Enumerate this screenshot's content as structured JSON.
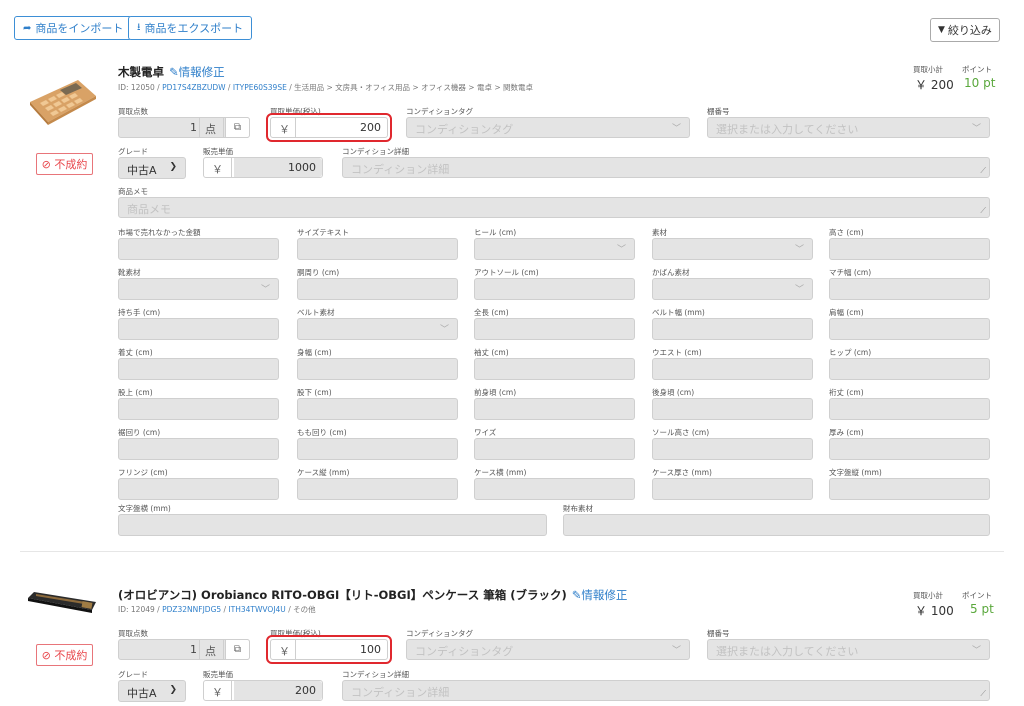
{
  "toolbar": {
    "import_label": "商品をインポート",
    "export_label": "商品をエクスポート",
    "filter_label": "絞り込み"
  },
  "labels": {
    "qty": "買取点数",
    "unit_price": "買取単価(税込)",
    "condition_tag": "コンディションタグ",
    "shelf": "棚番号",
    "grade": "グレード",
    "sale_price": "販売単価",
    "condition_detail": "コンディション詳細",
    "memo": "商品メモ",
    "subtotal": "買取小計",
    "points": "ポイント",
    "unit": "点",
    "yen": "￥",
    "not_contracted": "⊘ 不成約",
    "edit": "情報修正"
  },
  "placeholders": {
    "condition_tag": "コンディションタグ",
    "shelf": "選択または入力してください",
    "condition_detail": "コンディション詳細",
    "memo": "商品メモ"
  },
  "items": [
    {
      "title": "木製電卓",
      "id_text": "ID: 12050 / ",
      "code1": "PD17S4ZBZUDW",
      "code2": "ITYPE60S39SE",
      "category": " / 生活用品 > 文房具・オフィス用品 > オフィス機器 > 電卓 > 関数電卓",
      "qty": "1",
      "unit_price": "200",
      "grade": "中古A",
      "sale_price": "1000",
      "subtotal": "￥ 200",
      "points": "10 pt"
    },
    {
      "title": "(オロビアンコ) Orobianco RITO-OBGI【リト-OBGI】ペンケース 筆箱 (ブラック)",
      "id_text": "ID: 12049 / ",
      "code1": "PDZ32NNFJDG5",
      "code2": "ITH34TWVOJ4U",
      "category": " / その他",
      "qty": "1",
      "unit_price": "100",
      "grade": "中古A",
      "sale_price": "200",
      "subtotal": "￥ 100",
      "points": "5 pt"
    }
  ],
  "attributes": [
    [
      "市場で売れなかった金額",
      "サイズテキスト",
      "ヒール (cm)",
      "素材",
      "高さ (cm)"
    ],
    [
      "靴素材",
      "胴周り (cm)",
      "アウトソール (cm)",
      "かばん素材",
      "マチ幅 (cm)"
    ],
    [
      "持ち手 (cm)",
      "ベルト素材",
      "全長 (cm)",
      "ベルト幅 (mm)",
      "肩幅 (cm)"
    ],
    [
      "着丈 (cm)",
      "身幅 (cm)",
      "袖丈 (cm)",
      "ウエスト (cm)",
      "ヒップ (cm)"
    ],
    [
      "股上 (cm)",
      "股下 (cm)",
      "前身頃 (cm)",
      "後身頃 (cm)",
      "裄丈 (cm)"
    ],
    [
      "裾回り (cm)",
      "もも回り (cm)",
      "ワイズ",
      "ソール高さ (cm)",
      "厚み (cm)"
    ],
    [
      "フリンジ (cm)",
      "ケース縦 (mm)",
      "ケース横 (mm)",
      "ケース厚さ (mm)",
      "文字盤縦 (mm)"
    ]
  ],
  "attributes_last": [
    "文字盤横 (mm)",
    "財布素材"
  ]
}
